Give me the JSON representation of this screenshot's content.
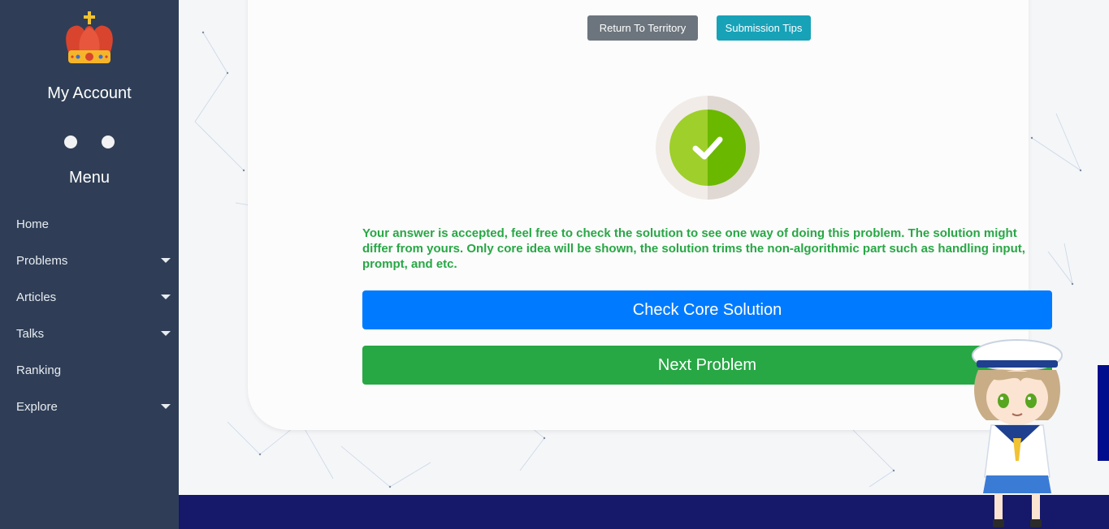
{
  "sidebar": {
    "account_title": "My Account",
    "menu_title": "Menu",
    "items": [
      {
        "label": "Home",
        "has_submenu": false
      },
      {
        "label": "Problems",
        "has_submenu": true
      },
      {
        "label": "Articles",
        "has_submenu": true
      },
      {
        "label": "Talks",
        "has_submenu": true
      },
      {
        "label": "Ranking",
        "has_submenu": false
      },
      {
        "label": "Explore",
        "has_submenu": true
      }
    ]
  },
  "toolbar": {
    "return_label": "Return To Territory",
    "tips_label": "Submission Tips"
  },
  "result": {
    "status_icon": "check-circle-icon",
    "message": "Your answer is accepted, feel free to check the solution to see one way of doing this problem. The solution might differ from yours. Only core idea will be shown, the solution trims the non-algorithmic part such as handling input, prompt, and etc."
  },
  "actions": {
    "check_solution_label": "Check Core Solution",
    "next_problem_label": "Next Problem"
  },
  "colors": {
    "sidebar_bg": "#2f3e56",
    "primary": "#007bff",
    "success": "#28a745",
    "info": "#17a2b8",
    "secondary": "#6c757d",
    "footer": "#16186a"
  }
}
